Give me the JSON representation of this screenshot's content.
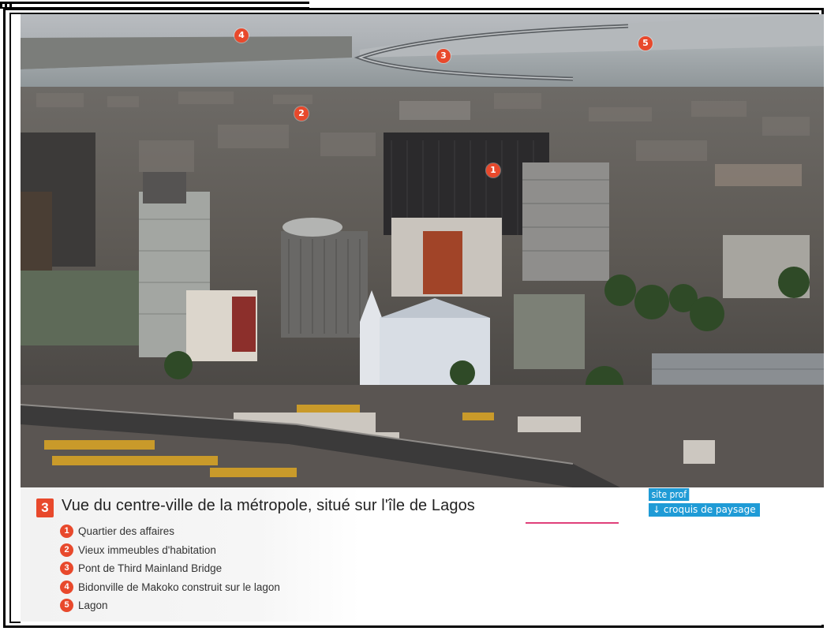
{
  "figure": {
    "number": "3",
    "title": "Vue du centre-ville de la métropole, situé sur l'île de Lagos"
  },
  "markers": [
    "1",
    "2",
    "3",
    "4",
    "5"
  ],
  "legend": [
    {
      "num": "1",
      "label": "Quartier des affaires"
    },
    {
      "num": "2",
      "label": "Vieux immeubles d'habitation"
    },
    {
      "num": "3",
      "label": "Pont de Third Mainland Bridge"
    },
    {
      "num": "4",
      "label": "Bidonville de Makoko construit sur le lagon"
    },
    {
      "num": "5",
      "label": "Lagon"
    }
  ],
  "site_prof": {
    "label": "site prof",
    "link": "↓ croquis de paysage"
  },
  "colors": {
    "accent": "#e8492c",
    "link": "#1f9bd6"
  }
}
